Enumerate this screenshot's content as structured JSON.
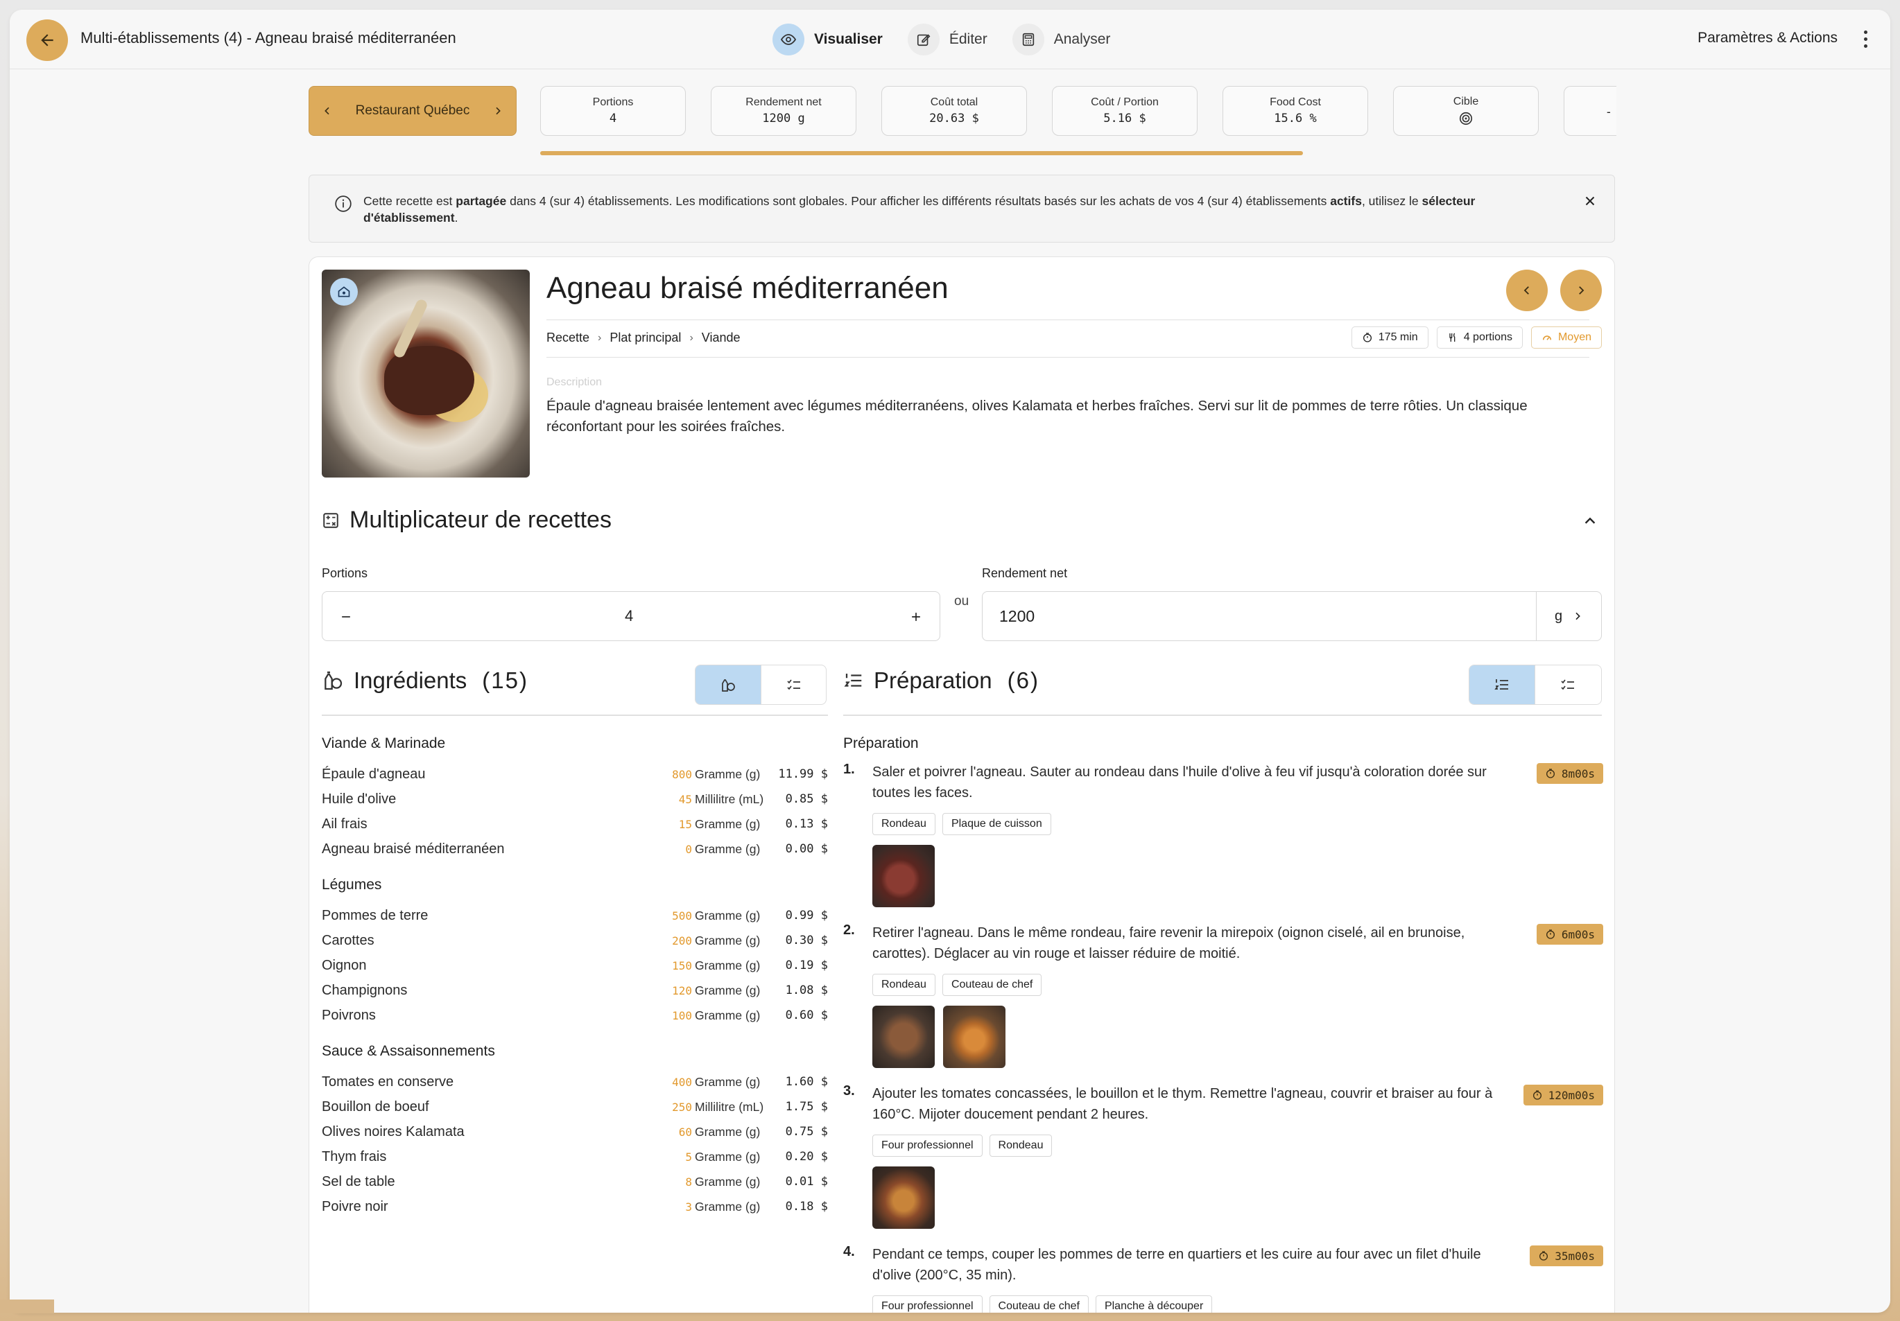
{
  "topbar": {
    "title": "Multi-établissements (4)  - Agneau braisé méditerranéen",
    "modes": [
      {
        "label": "Visualiser",
        "icon": "eye-icon",
        "active": true
      },
      {
        "label": "Éditer",
        "icon": "edit-icon",
        "active": false
      },
      {
        "label": "Analyser",
        "icon": "calculator-icon",
        "active": false
      }
    ],
    "actions_label": "Paramètres & Actions"
  },
  "metrics": {
    "restaurant": "Restaurant Québec",
    "cards": [
      {
        "label": "Portions",
        "value": "4"
      },
      {
        "label": "Rendement net",
        "value": "1200 g"
      },
      {
        "label": "Coût total",
        "value": "20.63 $"
      },
      {
        "label": "Coût / Portion",
        "value": "5.16 $"
      },
      {
        "label": "Food Cost",
        "value": "15.6 %"
      },
      {
        "label": "Cible",
        "value": ""
      },
      {
        "label": "",
        "value": "-"
      }
    ]
  },
  "banner": {
    "part1": "Cette recette est ",
    "bold1": "partagée",
    "part2": " dans 4 (sur 4) établissements. Les modifications sont globales. Pour afficher les différents résultats basés sur les achats de vos 4 (sur 4) établissements ",
    "bold2": "actifs",
    "part3": ", utilisez le ",
    "bold3": "sélecteur d'établissement",
    "part4": "."
  },
  "recipe": {
    "title": "Agneau braisé méditerranéen",
    "breadcrumb": [
      "Recette",
      "Plat principal",
      "Viande"
    ],
    "time": "175 min",
    "portions": "4 portions",
    "difficulty": "Moyen",
    "description_label": "Description",
    "description": "Épaule d'agneau braisée lentement avec légumes méditerranéens, olives Kalamata et herbes fraîches. Servi sur lit de pommes de terre rôties. Un classique réconfortant pour les soirées fraîches."
  },
  "multiplier": {
    "title": "Multiplicateur de recettes",
    "portions_label": "Portions",
    "portions_value": "4",
    "or_label": "ou",
    "yield_label": "Rendement net",
    "yield_value": "1200",
    "yield_unit": "g"
  },
  "ingredients": {
    "title": "Ingrédients",
    "count": "(15)",
    "groups": [
      {
        "name": "Viande & Marinade",
        "items": [
          {
            "name": "Épaule d'agneau",
            "qty": "800",
            "unit": "Gramme (g)",
            "cost": "11.99 $"
          },
          {
            "name": "Huile d'olive",
            "qty": "45",
            "unit": "Millilitre (mL)",
            "cost": "0.85 $"
          },
          {
            "name": "Ail frais",
            "qty": "15",
            "unit": "Gramme (g)",
            "cost": "0.13 $"
          },
          {
            "name": "Agneau braisé méditerranéen",
            "qty": "0",
            "unit": "Gramme (g)",
            "cost": "0.00 $"
          }
        ]
      },
      {
        "name": "Légumes",
        "items": [
          {
            "name": "Pommes de terre",
            "qty": "500",
            "unit": "Gramme (g)",
            "cost": "0.99 $"
          },
          {
            "name": "Carottes",
            "qty": "200",
            "unit": "Gramme (g)",
            "cost": "0.30 $"
          },
          {
            "name": "Oignon",
            "qty": "150",
            "unit": "Gramme (g)",
            "cost": "0.19 $"
          },
          {
            "name": "Champignons",
            "qty": "120",
            "unit": "Gramme (g)",
            "cost": "1.08 $"
          },
          {
            "name": "Poivrons",
            "qty": "100",
            "unit": "Gramme (g)",
            "cost": "0.60 $"
          }
        ]
      },
      {
        "name": "Sauce & Assaisonnements",
        "items": [
          {
            "name": "Tomates en conserve",
            "qty": "400",
            "unit": "Gramme (g)",
            "cost": "1.60 $"
          },
          {
            "name": "Bouillon de boeuf",
            "qty": "250",
            "unit": "Millilitre (mL)",
            "cost": "1.75 $"
          },
          {
            "name": "Olives noires Kalamata",
            "qty": "60",
            "unit": "Gramme (g)",
            "cost": "0.75 $"
          },
          {
            "name": "Thym frais",
            "qty": "5",
            "unit": "Gramme (g)",
            "cost": "0.20 $"
          },
          {
            "name": "Sel de table",
            "qty": "8",
            "unit": "Gramme (g)",
            "cost": "0.01 $"
          },
          {
            "name": "Poivre noir",
            "qty": "3",
            "unit": "Gramme (g)",
            "cost": "0.18 $"
          }
        ]
      }
    ]
  },
  "preparation": {
    "title": "Préparation",
    "count": "(6)",
    "section_title": "Préparation",
    "steps": [
      {
        "num": "1.",
        "text": "Saler et poivrer l'agneau. Sauter au rondeau dans l'huile d'olive à feu vif jusqu'à coloration dorée sur toutes les faces.",
        "timer": "8m00s",
        "tags": [
          "Rondeau",
          "Plaque de cuisson"
        ],
        "thumbs": [
          "t-meat"
        ]
      },
      {
        "num": "2.",
        "text": "Retirer l'agneau. Dans le même rondeau, faire revenir la mirepoix (oignon ciselé, ail en brunoise, carottes). Déglacer au vin rouge et laisser réduire de moitié.",
        "timer": "6m00s",
        "tags": [
          "Rondeau",
          "Couteau de chef"
        ],
        "thumbs": [
          "t-pan",
          "t-veg"
        ]
      },
      {
        "num": "3.",
        "text": "Ajouter les tomates concassées, le bouillon et le thym. Remettre l'agneau, couvrir et braiser au four à 160°C. Mijoter doucement pendant 2 heures.",
        "timer": "120m00s",
        "tags": [
          "Four professionnel",
          "Rondeau"
        ],
        "thumbs": [
          "t-stew"
        ]
      },
      {
        "num": "4.",
        "text": "Pendant ce temps, couper les pommes de terre en quartiers et les cuire au four avec un filet d'huile d'olive (200°C, 35 min).",
        "timer": "35m00s",
        "tags": [
          "Four professionnel",
          "Couteau de chef",
          "Planche à découper"
        ],
        "thumbs": []
      }
    ]
  },
  "colors": {
    "accent": "#ddab5b",
    "selected": "#bcd9f2",
    "qty": "#e2992d"
  }
}
